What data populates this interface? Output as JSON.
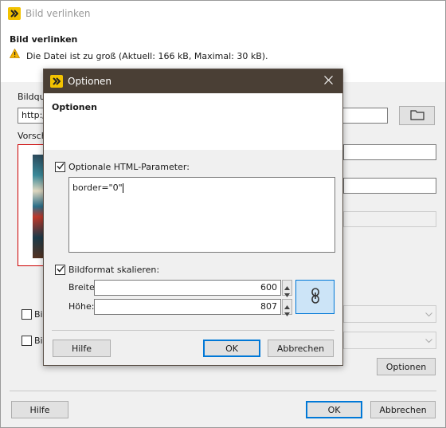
{
  "main_window": {
    "title": "Bild verlinken",
    "header_title": "Bild verlinken",
    "warning_text": "Die Datei ist zu groß (Aktuell: 166 kB, Maximal: 30 kB).",
    "bildquelle_label": "Bildque",
    "url_value": "http:/",
    "vorschau_label": "Vorsch",
    "checkbox1_label": "Bil",
    "checkbox2_label": "Bil",
    "optionen_button": "Optionen",
    "hilfe_button": "Hilfe",
    "ok_button": "OK",
    "abbrechen_button": "Abbrechen"
  },
  "dialog": {
    "title": "Optionen",
    "header_title": "Optionen",
    "html_params": {
      "checked": true,
      "label": "Optionale HTML-Parameter:",
      "value": "border=\"0\""
    },
    "scale": {
      "checked": true,
      "label": "Bildformat skalieren:",
      "breite_label": "Breite:",
      "breite_value": "600",
      "hoehe_label": "Höhe:",
      "hoehe_value": "807"
    },
    "hilfe_button": "Hilfe",
    "ok_button": "OK",
    "abbrechen_button": "Abbrechen"
  },
  "colors": {
    "accent": "#0078d7",
    "dialog_titlebar": "#4a3f35",
    "warning": "#f5b400",
    "link_button_bg": "#cce4f7"
  }
}
